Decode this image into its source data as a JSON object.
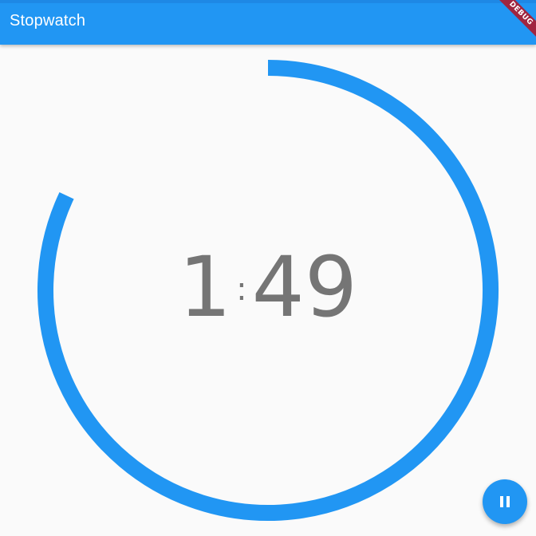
{
  "appbar": {
    "title": "Stopwatch",
    "color": "#2196f3"
  },
  "debug_banner": {
    "label": "DEBUG",
    "color": "#a02540"
  },
  "timer": {
    "minutes": "1",
    "separator": ":",
    "seconds": "49",
    "progress": 0.82,
    "ring_color": "#2196f3",
    "text_color": "#757575"
  },
  "fab": {
    "icon": "pause-icon",
    "color": "#2196f3"
  }
}
